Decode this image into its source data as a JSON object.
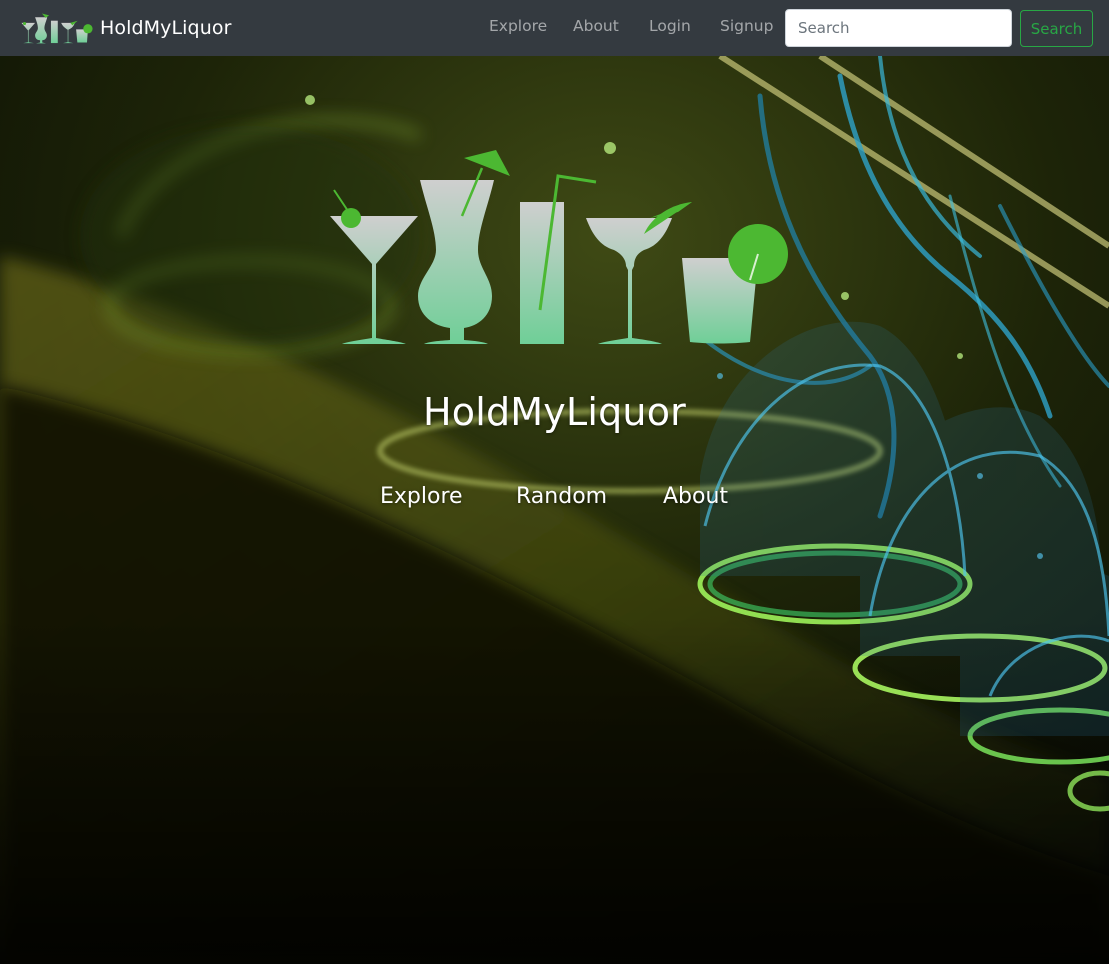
{
  "navbar": {
    "brand_name": "HoldMyLiquor",
    "links": [
      {
        "label": "Explore"
      },
      {
        "label": "About"
      },
      {
        "label": "Login"
      },
      {
        "label": "Signup"
      }
    ],
    "search": {
      "placeholder": "Search",
      "value": "",
      "button_label": "Search"
    }
  },
  "hero": {
    "title": "HoldMyLiquor",
    "links": [
      {
        "label": "Explore"
      },
      {
        "label": "Random"
      },
      {
        "label": "About"
      }
    ],
    "logo_icons": [
      "martini-glass-icon",
      "hurricane-glass-icon",
      "highball-glass-icon",
      "margarita-glass-icon",
      "rocks-glass-icon"
    ]
  },
  "colors": {
    "navbar_bg": "#343a40",
    "accent_green": "#28a745",
    "garnish_green": "#4cb832",
    "glass_gradient_top": "#c8c8c8",
    "glass_gradient_bottom": "#6fcf97"
  }
}
